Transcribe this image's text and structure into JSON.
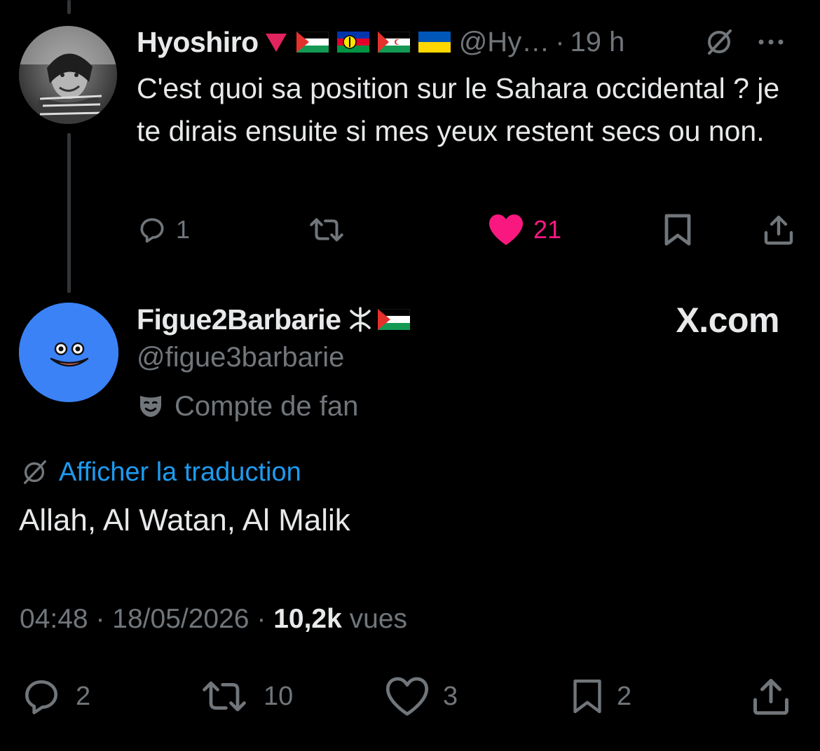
{
  "parent_tweet": {
    "display_name": "Hyoshiro",
    "handle": "@Hy…",
    "separator": "·",
    "time": "19 h",
    "text": "C'est quoi sa position sur le Sahara occidental ? je te dirais ensuite si mes yeux restent secs ou non.",
    "name_emojis": [
      "red-triangle-down",
      "palestine-flag",
      "kanak-flag",
      "sahrawi-flag",
      "ukraine-flag"
    ],
    "stats": {
      "replies": "1",
      "reposts": "",
      "likes": "21"
    },
    "liked": true,
    "colors": {
      "like": "#f91880"
    }
  },
  "main_tweet": {
    "display_name": "Figue2Barbarie",
    "name_emojis": [
      "tifinagh-yaz",
      "palestine-flag"
    ],
    "handle": "@figue3barbarie",
    "badge_label": "Compte de fan",
    "watermark": "X.com",
    "translate_label": "Afficher la traduction",
    "text": "Allah, Al Watan, Al Malik",
    "time": "04:48",
    "date": "18/05/2026",
    "separator": "·",
    "views_count": "10,2k",
    "views_label": "vues",
    "stats": {
      "replies": "2",
      "reposts": "10",
      "likes": "3",
      "bookmarks": "2"
    },
    "colors": {
      "avatar": "#3b82f6",
      "link": "#1d9bf0"
    }
  },
  "colors": {
    "background": "#000000",
    "text": "#e7e9ea",
    "muted": "#71767b"
  }
}
